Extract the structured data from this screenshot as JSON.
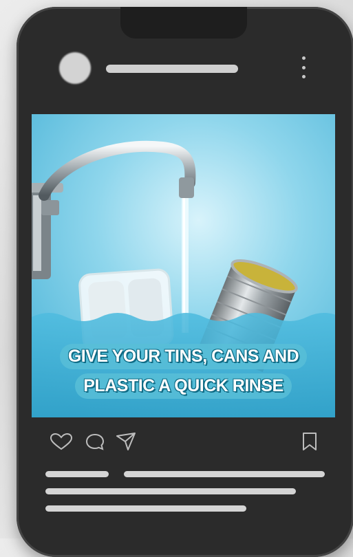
{
  "post": {
    "caption_lines": [
      "GIVE YOUR TINS, CANS AND",
      "PLASTIC A QUICK RINSE"
    ]
  },
  "icons": {
    "like": "heart-outline-icon",
    "comment": "comment-bubble-icon",
    "share": "paper-plane-icon",
    "save": "bookmark-outline-icon",
    "more": "vertical-ellipsis-icon"
  },
  "colors": {
    "sky": "#7fd0ea",
    "water": "#3fb0d3",
    "caption_fill": "#58bed7",
    "caption_stroke": "#0f6b85",
    "placeholder": "#d0d0d0"
  }
}
